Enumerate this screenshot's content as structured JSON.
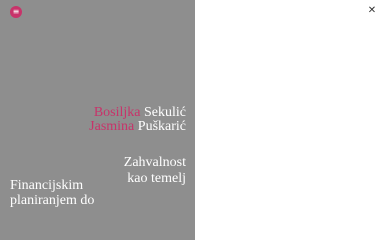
{
  "menu": {
    "icon": "menu-icon",
    "glyph": "≡"
  },
  "close": {
    "icon": "close-icon",
    "glyph": "✕"
  },
  "authors": [
    {
      "first": "Bosiljka",
      "last": "Sekulić"
    },
    {
      "first": "Jasmina",
      "last": "Puškarić"
    }
  ],
  "title": {
    "line1": "Zahvalnost",
    "line2": "kao temelj"
  },
  "subtitle": {
    "line1": "Financijskim",
    "line2": "planiranjem do"
  },
  "colors": {
    "accent": "#c8336a",
    "panel": "#8e8e8e",
    "background": "#ffffff"
  }
}
